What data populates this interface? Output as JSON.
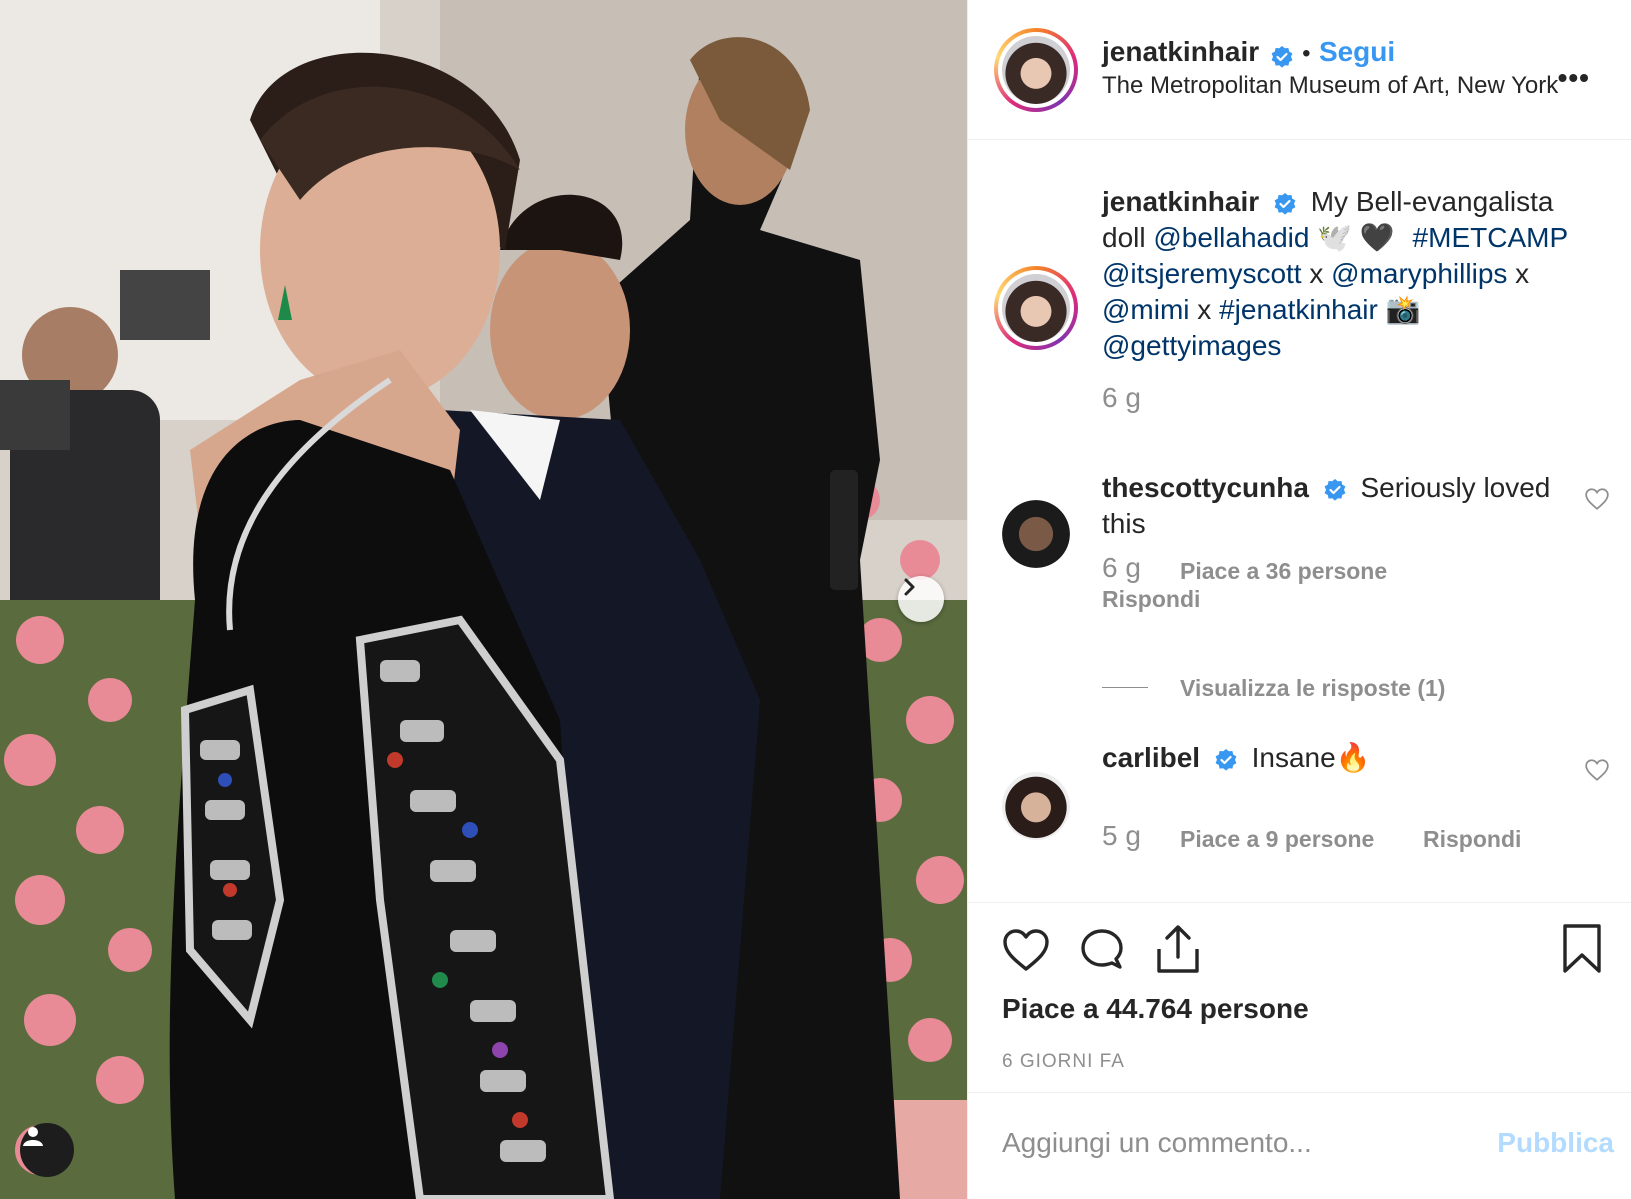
{
  "post": {
    "author": "jenatkinhair",
    "follow_label": "Segui",
    "dot": "•",
    "location": "The Metropolitan Museum of Art, New York",
    "more_label": "•••"
  },
  "caption": {
    "username": "jenatkinhair",
    "line1": "My Bell-evangalista",
    "line2_a": "doll",
    "line2_mention": "@bellahadid",
    "line2_emoji": "🕊️ 🖤",
    "line2_tag": "#METCAMP",
    "line3_m1": "@itsjeremyscott",
    "x1": "x",
    "line3_m2": "@maryphillips",
    "x2": "x",
    "line4_m1": "@mimi",
    "x3": "x",
    "line4_tag": "#jenatkinhair",
    "line4_emoji": "📸",
    "line5_m1": "@gettyimages",
    "time": "6 g"
  },
  "comments": [
    {
      "username": "thescottycunha",
      "text1": "Seriously loved",
      "text2": "this",
      "time": "6 g",
      "likes": "Piace a 36 persone",
      "reply": "Rispondi",
      "view_replies": "Visualizza le risposte (1)"
    },
    {
      "username": "carlibel",
      "text": "Insane🔥",
      "time": "5 g",
      "likes": "Piace a 9 persone",
      "reply": "Rispondi"
    }
  ],
  "likes_total": "Piace a 44.764 persone",
  "date": "6 GIORNI FA",
  "add_comment": {
    "placeholder": "Aggiungi un commento...",
    "publish_label": "Pubblica"
  },
  "colors": {
    "accent": "#3897f0",
    "publish_disabled": "#b3dbff",
    "secondary": "#8e8e8e"
  },
  "icons": [
    "heart-icon",
    "comment-icon",
    "share-icon",
    "bookmark-icon",
    "chevron-right-icon",
    "user-tag-icon",
    "verified-badge-icon"
  ]
}
